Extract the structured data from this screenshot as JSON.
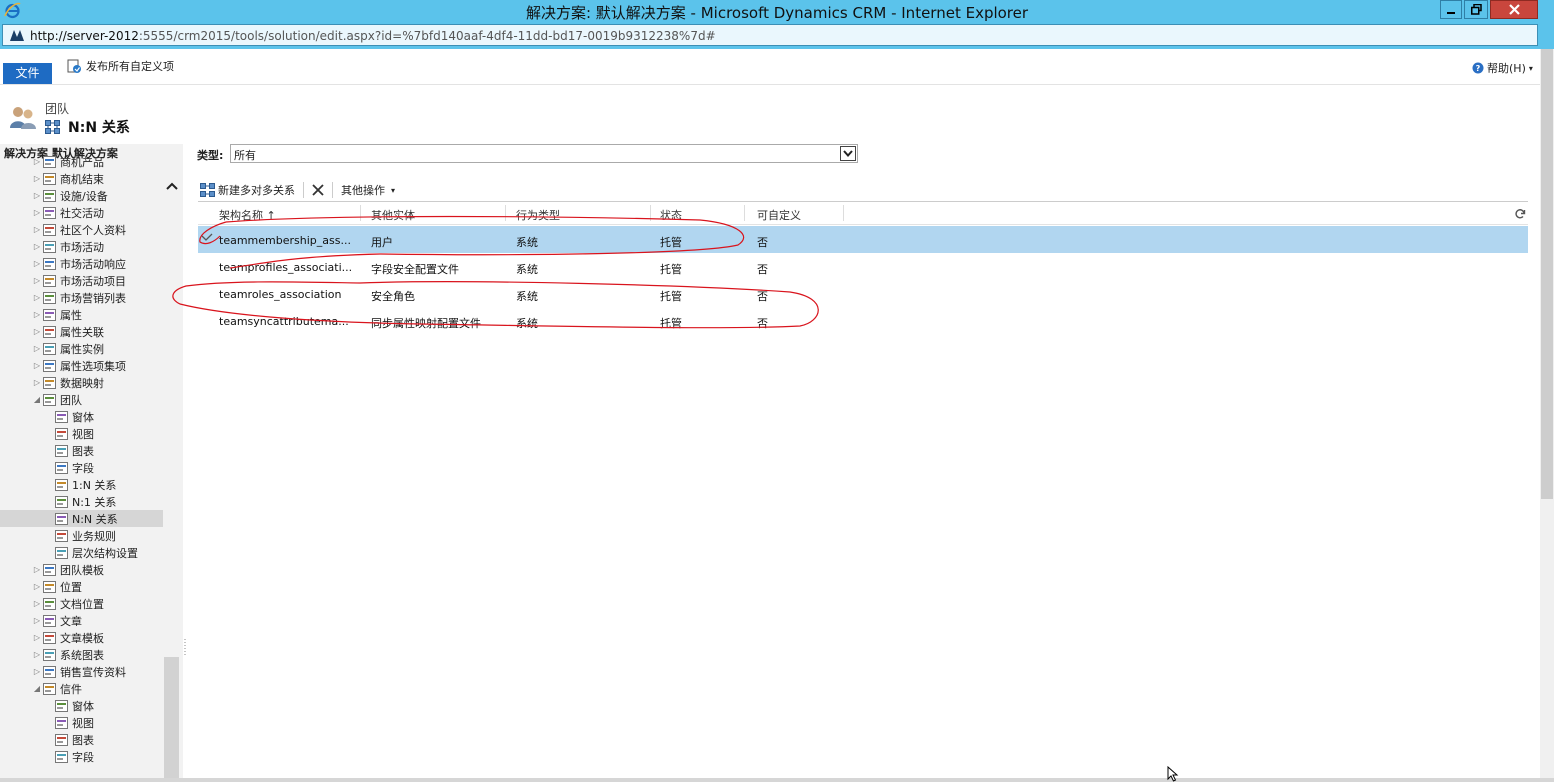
{
  "window": {
    "title": "解决方案: 默认解决方案 - Microsoft Dynamics CRM - Internet Explorer",
    "url_host": "http://server-2012",
    "url_rest": ":5555/crm2015/tools/solution/edit.aspx?id=%7bfd140aaf-4df4-11dd-bd17-0019b9312238%7d#"
  },
  "command_bar": {
    "file_label": "文件",
    "publish_label": "发布所有自定义项",
    "help_label": "帮助(H)"
  },
  "entity_header": {
    "parent": "团队",
    "current": "N:N 关系"
  },
  "nav": {
    "title": "解决方案 默认解决方案",
    "items": [
      {
        "label": "商机产品",
        "level": 0,
        "expand": "collapsed"
      },
      {
        "label": "商机结束",
        "level": 0,
        "expand": "collapsed"
      },
      {
        "label": "设施/设备",
        "level": 0,
        "expand": "collapsed"
      },
      {
        "label": "社交活动",
        "level": 0,
        "expand": "collapsed"
      },
      {
        "label": "社区个人资料",
        "level": 0,
        "expand": "collapsed"
      },
      {
        "label": "市场活动",
        "level": 0,
        "expand": "collapsed"
      },
      {
        "label": "市场活动响应",
        "level": 0,
        "expand": "collapsed"
      },
      {
        "label": "市场活动项目",
        "level": 0,
        "expand": "collapsed"
      },
      {
        "label": "市场营销列表",
        "level": 0,
        "expand": "collapsed"
      },
      {
        "label": "属性",
        "level": 0,
        "expand": "collapsed"
      },
      {
        "label": "属性关联",
        "level": 0,
        "expand": "collapsed"
      },
      {
        "label": "属性实例",
        "level": 0,
        "expand": "collapsed"
      },
      {
        "label": "属性选项集项",
        "level": 0,
        "expand": "collapsed"
      },
      {
        "label": "数据映射",
        "level": 0,
        "expand": "collapsed"
      },
      {
        "label": "团队",
        "level": 0,
        "expand": "expanded"
      },
      {
        "label": "窗体",
        "level": 1,
        "expand": "none"
      },
      {
        "label": "视图",
        "level": 1,
        "expand": "none"
      },
      {
        "label": "图表",
        "level": 1,
        "expand": "none"
      },
      {
        "label": "字段",
        "level": 1,
        "expand": "none"
      },
      {
        "label": "1:N 关系",
        "level": 1,
        "expand": "none"
      },
      {
        "label": "N:1 关系",
        "level": 1,
        "expand": "none"
      },
      {
        "label": "N:N 关系",
        "level": 1,
        "expand": "none",
        "selected": true
      },
      {
        "label": "业务规则",
        "level": 1,
        "expand": "none"
      },
      {
        "label": "层次结构设置",
        "level": 1,
        "expand": "none"
      },
      {
        "label": "团队模板",
        "level": 0,
        "expand": "collapsed"
      },
      {
        "label": "位置",
        "level": 0,
        "expand": "collapsed"
      },
      {
        "label": "文档位置",
        "level": 0,
        "expand": "collapsed"
      },
      {
        "label": "文章",
        "level": 0,
        "expand": "collapsed"
      },
      {
        "label": "文章模板",
        "level": 0,
        "expand": "collapsed"
      },
      {
        "label": "系统图表",
        "level": 0,
        "expand": "collapsed"
      },
      {
        "label": "销售宣传资料",
        "level": 0,
        "expand": "collapsed"
      },
      {
        "label": "信件",
        "level": 0,
        "expand": "expanded"
      },
      {
        "label": "窗体",
        "level": 1,
        "expand": "none"
      },
      {
        "label": "视图",
        "level": 1,
        "expand": "none"
      },
      {
        "label": "图表",
        "level": 1,
        "expand": "none"
      },
      {
        "label": "字段",
        "level": 1,
        "expand": "none"
      }
    ]
  },
  "filter": {
    "label": "类型:",
    "value": "所有"
  },
  "toolbar": {
    "new_label": "新建多对多关系",
    "more_label": "其他操作"
  },
  "grid": {
    "columns": [
      "架构名称 ↑",
      "其他实体",
      "行为类型",
      "状态",
      "可自定义"
    ],
    "rows": [
      {
        "schema": "teammembership_ass...",
        "entity": "用户",
        "behavior": "系统",
        "state": "托管",
        "custom": "否",
        "selected": true
      },
      {
        "schema": "teamprofiles_associati...",
        "entity": "字段安全配置文件",
        "behavior": "系统",
        "state": "托管",
        "custom": "否"
      },
      {
        "schema": "teamroles_association",
        "entity": "安全角色",
        "behavior": "系统",
        "state": "托管",
        "custom": "否"
      },
      {
        "schema": "teamsyncattributema...",
        "entity": "同步属性映射配置文件",
        "behavior": "系统",
        "state": "托管",
        "custom": "否"
      }
    ]
  },
  "colors": {
    "titlebar": "#5bc3eb",
    "accent": "#1e6bc3",
    "selected_row": "#b1d6f0",
    "annotation": "#d9141d"
  }
}
